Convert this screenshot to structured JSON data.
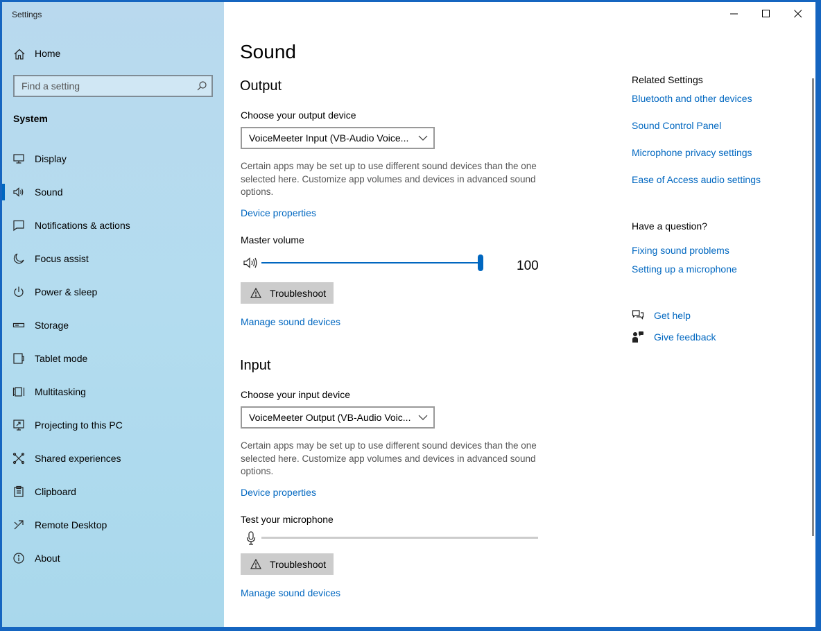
{
  "window": {
    "title": "Settings",
    "controls": [
      "minimize",
      "maximize",
      "close"
    ]
  },
  "sidebar": {
    "home_label": "Home",
    "search_placeholder": "Find a setting",
    "section_label": "System",
    "items": [
      {
        "label": "Display",
        "icon": "monitor-icon"
      },
      {
        "label": "Sound",
        "icon": "speaker-icon",
        "active": true
      },
      {
        "label": "Notifications & actions",
        "icon": "notification-icon"
      },
      {
        "label": "Focus assist",
        "icon": "moon-icon"
      },
      {
        "label": "Power & sleep",
        "icon": "power-icon"
      },
      {
        "label": "Storage",
        "icon": "storage-icon"
      },
      {
        "label": "Tablet mode",
        "icon": "tablet-icon"
      },
      {
        "label": "Multitasking",
        "icon": "multitasking-icon"
      },
      {
        "label": "Projecting to this PC",
        "icon": "projector-icon"
      },
      {
        "label": "Shared experiences",
        "icon": "shared-icon"
      },
      {
        "label": "Clipboard",
        "icon": "clipboard-icon"
      },
      {
        "label": "Remote Desktop",
        "icon": "remote-desktop-icon"
      },
      {
        "label": "About",
        "icon": "info-icon"
      }
    ]
  },
  "main": {
    "page_title": "Sound",
    "output": {
      "heading": "Output",
      "device_label": "Choose your output device",
      "device_value": "VoiceMeeter Input (VB-Audio Voice...",
      "description": "Certain apps may be set up to use different sound devices than the one selected here. Customize app volumes and devices in advanced sound options.",
      "device_properties_link": "Device properties",
      "master_volume_label": "Master volume",
      "volume_value": "100",
      "volume_level": 1.0,
      "troubleshoot_label": "Troubleshoot",
      "manage_link": "Manage sound devices"
    },
    "input": {
      "heading": "Input",
      "device_label": "Choose your input device",
      "device_value": "VoiceMeeter Output (VB-Audio Voic...",
      "description": "Certain apps may be set up to use different sound devices than the one selected here. Customize app volumes and devices in advanced sound options.",
      "device_properties_link": "Device properties",
      "test_label": "Test your microphone",
      "mic_level": 0,
      "troubleshoot_label": "Troubleshoot",
      "manage_link": "Manage sound devices"
    }
  },
  "related": {
    "heading": "Related Settings",
    "links": [
      "Bluetooth and other devices",
      "Sound Control Panel",
      "Microphone privacy settings",
      "Ease of Access audio settings"
    ],
    "question_heading": "Have a question?",
    "question_links": [
      "Fixing sound problems",
      "Setting up a microphone"
    ],
    "get_help": "Get help",
    "give_feedback": "Give feedback"
  },
  "colors": {
    "accent": "#0067c0",
    "sidebar_bg": "#b3dcef",
    "desktop": "#1565c0"
  }
}
